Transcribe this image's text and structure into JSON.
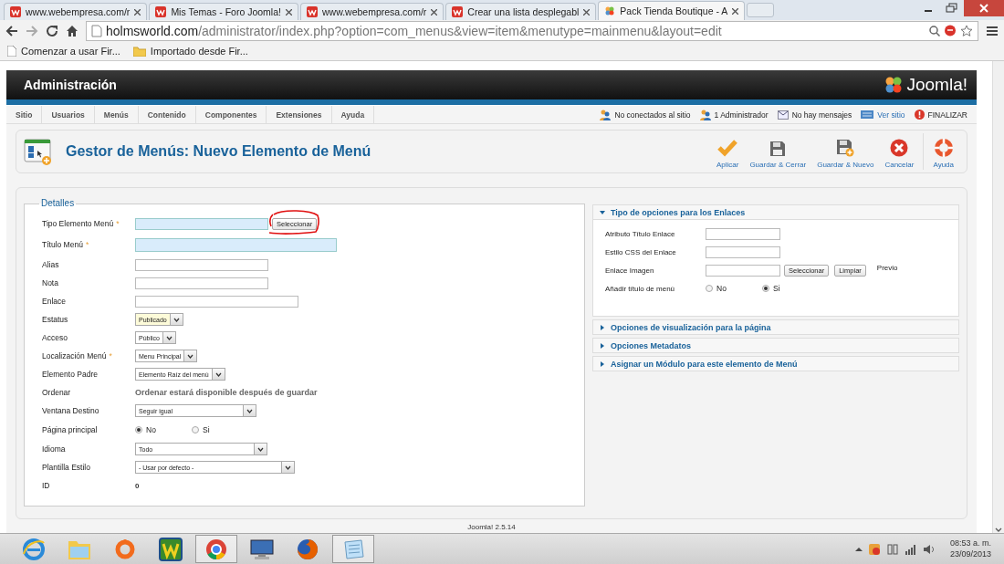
{
  "browser": {
    "tabs": [
      {
        "title": "www.webempresa.com/r",
        "selected": false,
        "kind": "site"
      },
      {
        "title": "Mis Temas - Foro Joomla!",
        "selected": false,
        "kind": "site"
      },
      {
        "title": "www.webempresa.com/r",
        "selected": false,
        "kind": "site"
      },
      {
        "title": "Crear una lista desplegabl",
        "selected": false,
        "kind": "site"
      },
      {
        "title": "Pack Tienda Boutique - A",
        "selected": true,
        "kind": "joomla"
      }
    ],
    "url_host": "holmsworld.com",
    "url_path": "/administrator/index.php?option=com_menus&view=item&menutype=mainmenu&layout=edit",
    "bookmarks": [
      {
        "label": "Comenzar a usar Fir...",
        "kind": "page"
      },
      {
        "label": "Importado desde Fir...",
        "kind": "folder"
      }
    ]
  },
  "header": {
    "title": "Administración",
    "logo": "Joomla!"
  },
  "menu": [
    "Sitio",
    "Usuarios",
    "Menús",
    "Contenido",
    "Componentes",
    "Extensiones",
    "Ayuda"
  ],
  "status": [
    {
      "text": "No conectados al sitio",
      "kind": "users"
    },
    {
      "text": "1 Administrador",
      "kind": "users"
    },
    {
      "text": "No hay mensajes",
      "kind": "mail"
    },
    {
      "text": "Ver sitio",
      "kind": "link"
    },
    {
      "text": "FINALIZAR",
      "kind": "logout"
    }
  ],
  "toolbar": {
    "title": "Gestor de Menús: Nuevo Elemento de Menú",
    "buttons": [
      {
        "label": "Aplicar",
        "kind": "apply"
      },
      {
        "label": "Guardar & Cerrar",
        "kind": "save"
      },
      {
        "label": "Guardar & Nuevo",
        "kind": "save-new"
      },
      {
        "label": "Cancelar",
        "kind": "cancel"
      },
      {
        "label": "Ayuda",
        "kind": "help"
      }
    ]
  },
  "details": {
    "legend": "Detalles",
    "fields": [
      {
        "label": "Tipo Elemento Menú",
        "marker": "*",
        "kind": "text",
        "highlighted": true,
        "button": "Seleccionar",
        "marked": true
      },
      {
        "label": "Título Menú",
        "marker": "*",
        "kind": "text",
        "highlighted": true
      },
      {
        "label": "Alias",
        "kind": "text",
        "highlighted": false
      },
      {
        "label": "Nota",
        "kind": "text",
        "highlighted": false
      },
      {
        "label": "Enlace",
        "kind": "text",
        "highlighted": false
      },
      {
        "label": "Estatus",
        "kind": "select",
        "value": "Publicado",
        "highlighted": true
      },
      {
        "label": "Acceso",
        "kind": "select",
        "value": "Público",
        "highlighted": false
      },
      {
        "label": "Localización Menú",
        "marker": "*",
        "kind": "select",
        "value": "Menu Principal",
        "highlighted": false
      },
      {
        "label": "Elemento Padre",
        "kind": "select",
        "value": "Elemento Raíz del menú",
        "highlighted": false
      },
      {
        "label": "Ordenar",
        "kind": "note",
        "value": "Ordenar estará disponible después de guardar"
      },
      {
        "label": "Ventana Destino",
        "kind": "select",
        "value": "Seguir igual",
        "highlighted": false
      },
      {
        "label": "Página principal",
        "kind": "radio",
        "options": [
          {
            "label": "No",
            "selected": true
          },
          {
            "label": "Si",
            "selected": false
          }
        ]
      },
      {
        "label": "Idioma",
        "kind": "select",
        "value": "Todo",
        "highlighted": false
      },
      {
        "label": "Plantilla Estilo",
        "kind": "select",
        "value": "- Usar por defecto -",
        "highlighted": false
      },
      {
        "label": "ID",
        "kind": "value",
        "value": "0"
      }
    ]
  },
  "options": [
    {
      "title": "Tipo de opciones para los Enlaces",
      "expanded": true,
      "fields": [
        {
          "label": "Atributo Título Enlace",
          "kind": "text"
        },
        {
          "label": "Estilo CSS del Enlace",
          "kind": "text"
        },
        {
          "label": "Enlace Imagen",
          "kind": "image",
          "buttons": [
            "Seleccionar",
            "Limpiar"
          ],
          "preview": "Previo"
        },
        {
          "label": "Añadir título de menú",
          "kind": "radio",
          "options": [
            {
              "label": "No",
              "selected": false
            },
            {
              "label": "Si",
              "selected": true
            }
          ]
        }
      ]
    },
    {
      "title": "Opciones de visualización para la página",
      "expanded": false
    },
    {
      "title": "Opciones Metadatos",
      "expanded": false
    },
    {
      "title": "Asignar un Módulo para este elemento de Menú",
      "expanded": false
    }
  ],
  "footer": "Joomla! 2.5.14",
  "taskbar": {
    "apps": [
      {
        "kind": "browser-e",
        "selected": false
      },
      {
        "kind": "folder",
        "selected": false
      },
      {
        "kind": "orange",
        "selected": false
      },
      {
        "kind": "green",
        "selected": false
      },
      {
        "kind": "chrome",
        "selected": true
      },
      {
        "kind": "monitor",
        "selected": false
      },
      {
        "kind": "firefox",
        "selected": false
      },
      {
        "kind": "notepad",
        "selected": true
      }
    ],
    "time": "08:53 a. m.",
    "date": "23/09/2013"
  }
}
